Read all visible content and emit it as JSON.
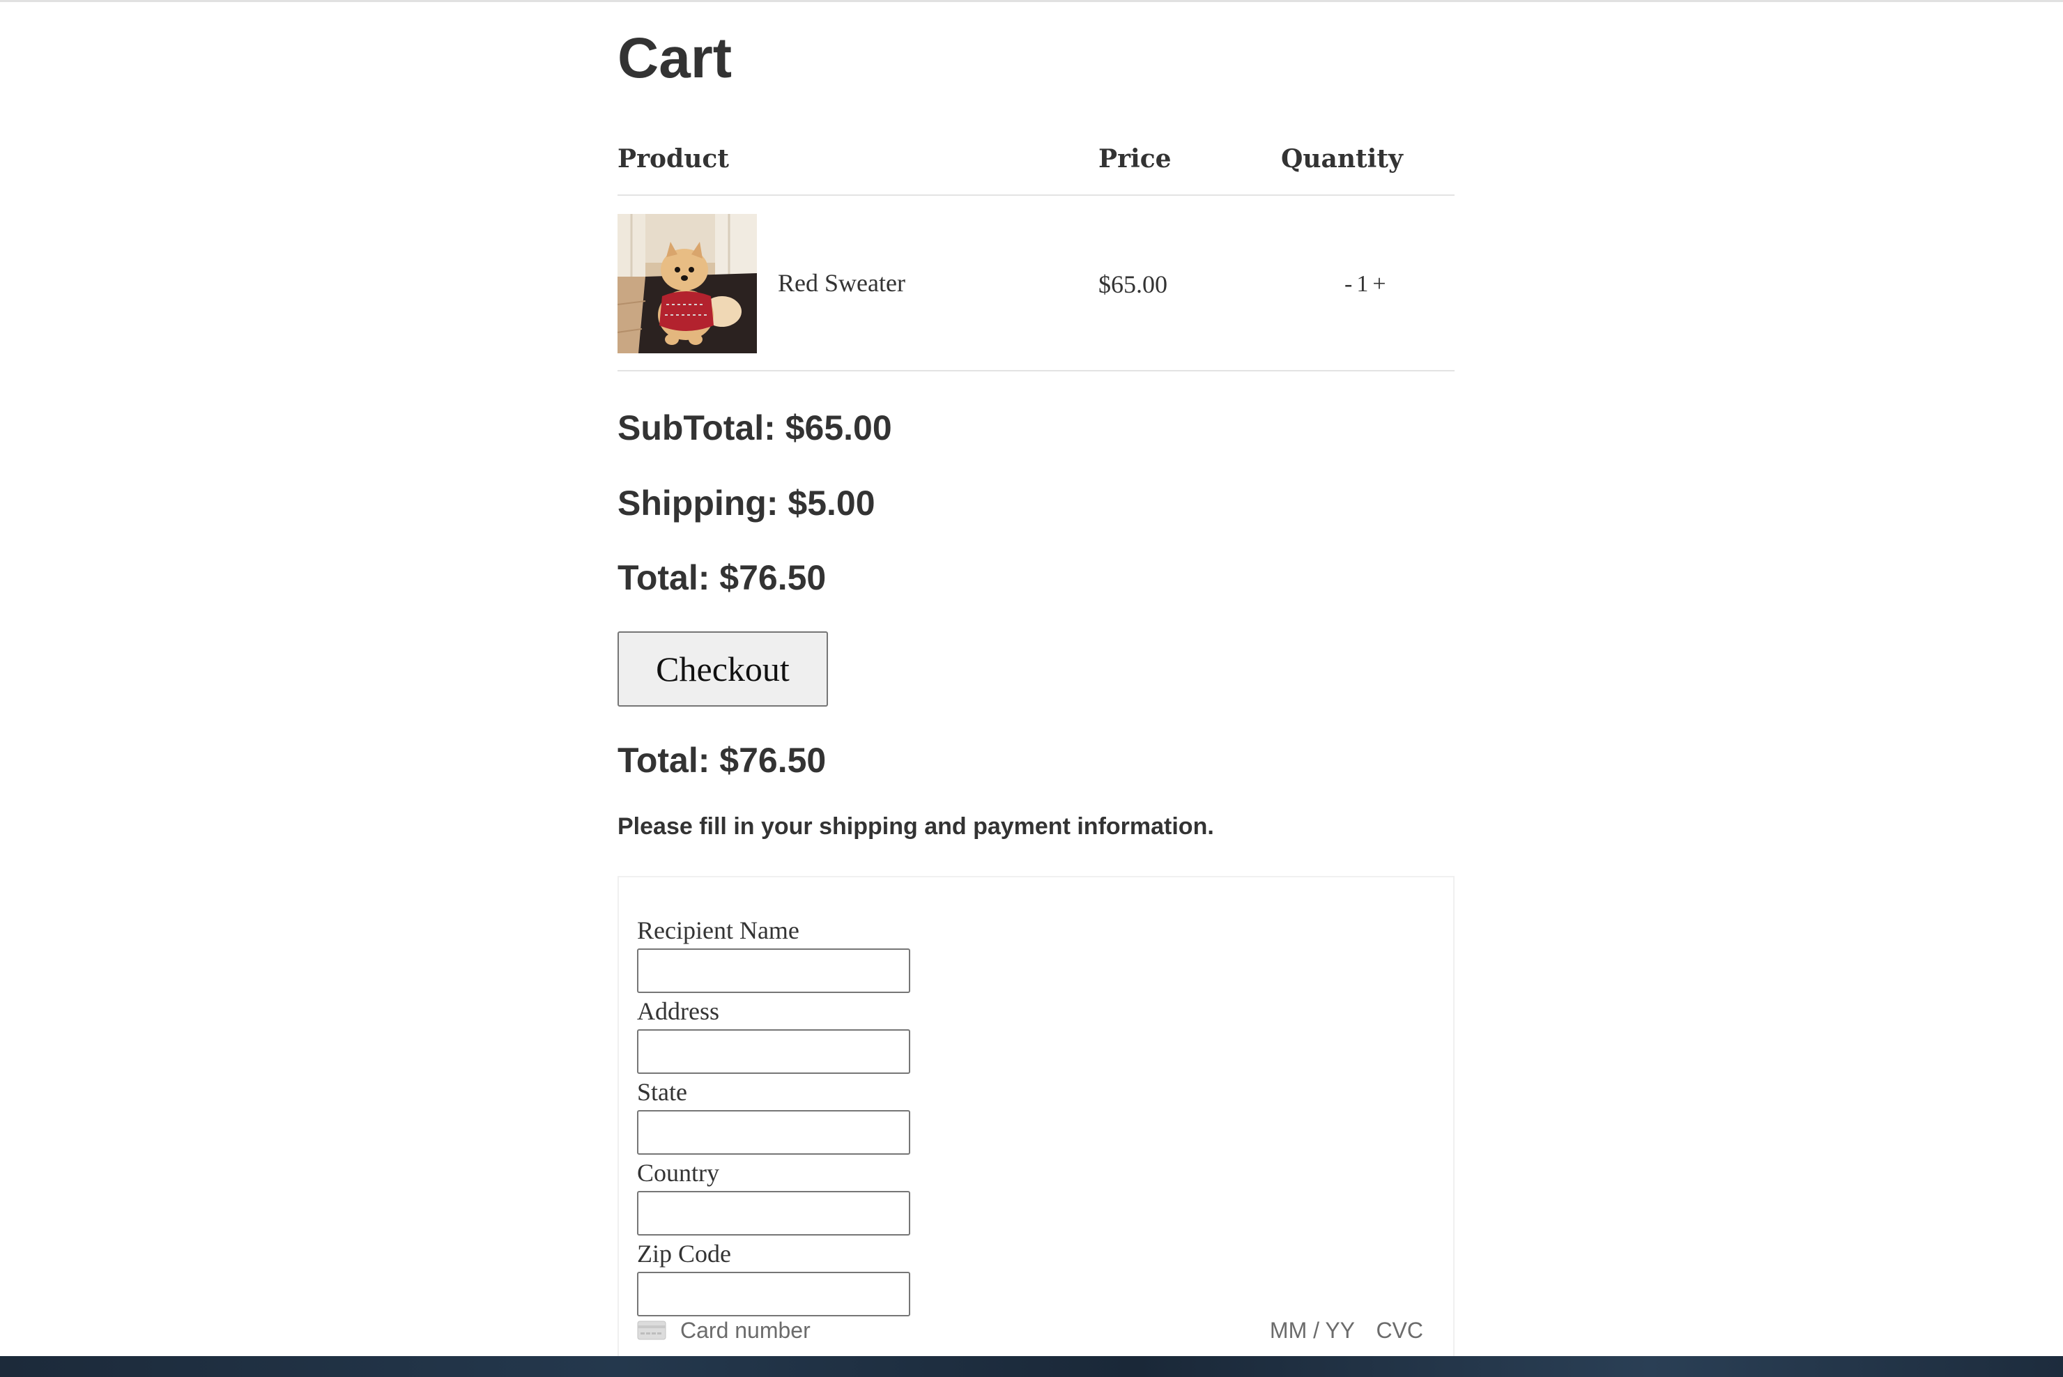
{
  "page": {
    "title": "Cart"
  },
  "table": {
    "headers": {
      "product": "Product",
      "price": "Price",
      "quantity": "Quantity"
    },
    "items": [
      {
        "name": "Red Sweater",
        "price": "$65.00",
        "quantity": "1",
        "decrement": "-",
        "increment": "+",
        "image": "dog-in-red-sweater-photo"
      }
    ]
  },
  "summary": {
    "subtotal": "SubTotal: $65.00",
    "shipping": "Shipping: $5.00",
    "total": "Total: $76.50"
  },
  "checkout": {
    "button_label": "Checkout",
    "total": "Total: $76.50",
    "instructions": "Please fill in your shipping and payment information."
  },
  "form": {
    "fields": [
      {
        "label": "Recipient Name",
        "value": ""
      },
      {
        "label": "Address",
        "value": ""
      },
      {
        "label": "State",
        "value": ""
      },
      {
        "label": "Country",
        "value": ""
      },
      {
        "label": "Zip Code",
        "value": ""
      }
    ],
    "card": {
      "icon": "credit-card-icon",
      "number_placeholder": "Card number",
      "expiry_placeholder": "MM / YY",
      "cvc_placeholder": "CVC"
    }
  },
  "colors": {
    "text": "#333333",
    "divider": "#e3e3e3",
    "button_bg": "#efefef",
    "input_border": "#767676",
    "placeholder": "#6b6b6b",
    "footer": "#1c2a3a"
  }
}
